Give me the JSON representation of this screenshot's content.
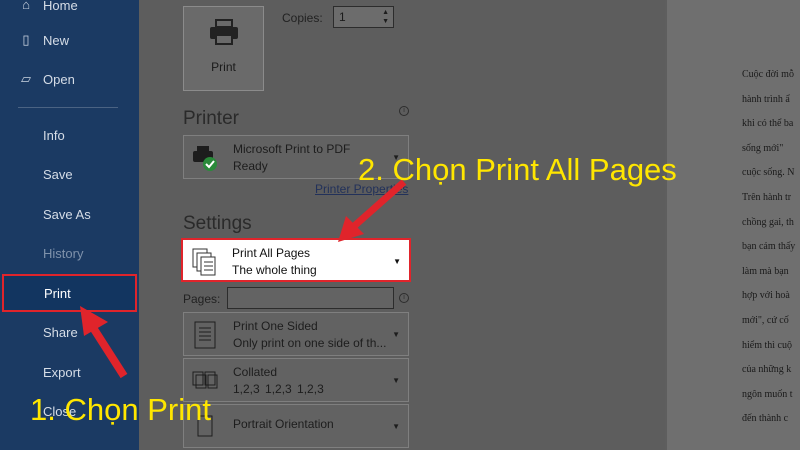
{
  "nav": {
    "items": [
      {
        "label": "Home",
        "icon": "home-icon",
        "glyph": "⌂"
      },
      {
        "label": "New",
        "icon": "new-document-icon",
        "glyph": "▯"
      },
      {
        "label": "Open",
        "icon": "open-folder-icon",
        "glyph": "▱"
      },
      {
        "label": "Info"
      },
      {
        "label": "Save"
      },
      {
        "label": "Save As"
      },
      {
        "label": "History"
      },
      {
        "label": "Print"
      },
      {
        "label": "Share"
      },
      {
        "label": "Export"
      },
      {
        "label": "Close"
      }
    ]
  },
  "print": {
    "button_label": "Print",
    "copies_label": "Copies:",
    "copies_value": "1"
  },
  "printer": {
    "title": "Printer",
    "name": "Microsoft Print to PDF",
    "status": "Ready",
    "properties_link": "Printer Properties"
  },
  "settings": {
    "title": "Settings",
    "range_main": "Print All Pages",
    "range_sub": "The whole thing",
    "pages_label": "Pages:",
    "pages_value": "",
    "sided_main": "Print One Sided",
    "sided_sub": "Only print on one side of th...",
    "collate_main": "Collated",
    "collate_sub": "1,2,3    1,2,3    1,2,3",
    "orientation_main": "Portrait Orientation"
  },
  "preview": {
    "lines": [
      "Cuộc đời mỗ",
      "hành trình ẩ",
      "khi có thể ba",
      "sống mới\"",
      "cuộc sống. N",
      "Trên hành tr",
      "chồng gai, th",
      "bạn cảm thấy",
      "làm mà bạn",
      "hợp với hoà",
      "mới\", cứ cố",
      "hiểm thì cuộ",
      "của những k",
      "ngôn muốn t",
      "đến thành c"
    ]
  },
  "annotations": {
    "step1": "1. Chọn Print",
    "step2": "2. Chọn Print All Pages",
    "color": "#ffe600",
    "highlight_color": "#e0242b"
  }
}
